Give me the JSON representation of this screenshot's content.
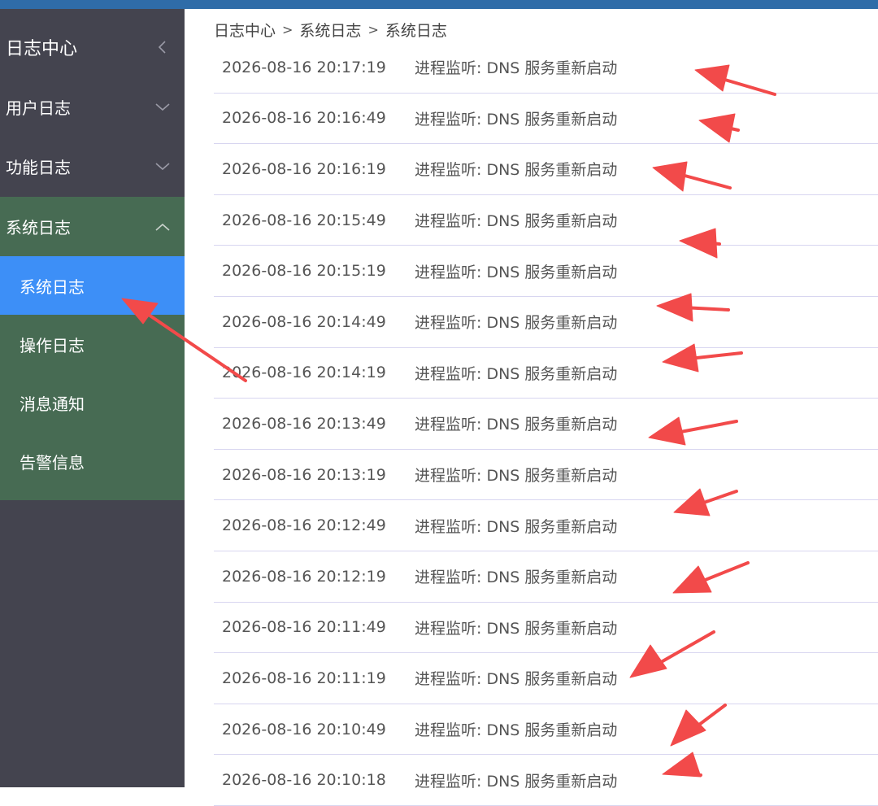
{
  "sidebar": {
    "title": "日志中心",
    "menus": [
      {
        "label": "用户日志"
      },
      {
        "label": "功能日志"
      },
      {
        "label": "系统日志"
      }
    ],
    "submenu": [
      {
        "label": "系统日志"
      },
      {
        "label": "操作日志"
      },
      {
        "label": "消息通知"
      },
      {
        "label": "告警信息"
      }
    ]
  },
  "breadcrumb": [
    "日志中心",
    "系统日志",
    "系统日志"
  ],
  "logs": [
    {
      "time": "2026-08-16 20:17:19",
      "message": "进程监听: DNS 服务重新启动"
    },
    {
      "time": "2026-08-16 20:16:49",
      "message": "进程监听: DNS 服务重新启动"
    },
    {
      "time": "2026-08-16 20:16:19",
      "message": "进程监听: DNS 服务重新启动"
    },
    {
      "time": "2026-08-16 20:15:49",
      "message": "进程监听: DNS 服务重新启动"
    },
    {
      "time": "2026-08-16 20:15:19",
      "message": "进程监听: DNS 服务重新启动"
    },
    {
      "time": "2026-08-16 20:14:49",
      "message": "进程监听: DNS 服务重新启动"
    },
    {
      "time": "2026-08-16 20:14:19",
      "message": "进程监听: DNS 服务重新启动"
    },
    {
      "time": "2026-08-16 20:13:49",
      "message": "进程监听: DNS 服务重新启动"
    },
    {
      "time": "2026-08-16 20:13:19",
      "message": "进程监听: DNS 服务重新启动"
    },
    {
      "time": "2026-08-16 20:12:49",
      "message": "进程监听: DNS 服务重新启动"
    },
    {
      "time": "2026-08-16 20:12:19",
      "message": "进程监听: DNS 服务重新启动"
    },
    {
      "time": "2026-08-16 20:11:49",
      "message": "进程监听: DNS 服务重新启动"
    },
    {
      "time": "2026-08-16 20:11:19",
      "message": "进程监听: DNS 服务重新启动"
    },
    {
      "time": "2026-08-16 20:10:49",
      "message": "进程监听: DNS 服务重新启动"
    },
    {
      "time": "2026-08-16 20:10:18",
      "message": "进程监听: DNS 服务重新启动"
    }
  ],
  "colors": {
    "topbar": "#2f6ca8",
    "sidebar": "#44444f",
    "expanded_menu": "#476b53",
    "active_item": "#3d8ff7",
    "annotation_arrow": "#f24a4a"
  }
}
